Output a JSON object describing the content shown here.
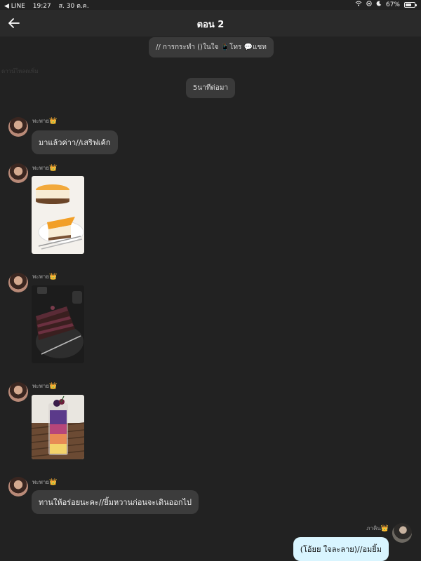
{
  "status_bar": {
    "carrier": "◀ LINE",
    "time": "19:27",
    "date": "ส. 30 ต.ค.",
    "battery": "67%",
    "battery_level": 0.67
  },
  "header": {
    "title": "ตอน 2"
  },
  "system_messages": [
    {
      "text": "// การกระทำ ()ในใจ 📱โทร 💬แชท"
    },
    {
      "text": "5นาทีต่อมา"
    }
  ],
  "faint_text": "ดาวน์โหลดเพิ่ม",
  "messages": [
    {
      "sender": "พะพาย",
      "badge": "👑",
      "text": "มาแล้วค่าา//เสริฟเค้ก"
    },
    {
      "sender": "พะพาย",
      "badge": "👑",
      "image": "orange-cheesecake"
    },
    {
      "sender": "พะพาย",
      "badge": "👑",
      "image": "chocolate-cake"
    },
    {
      "sender": "พะพาย",
      "badge": "👑",
      "image": "berry-drink"
    },
    {
      "sender": "พะพาย",
      "badge": "👑",
      "text": "ทานให้อร่อยนะคะ//ยิ้มหวานก่อนจะเดินออกไป"
    },
    {
      "sender": "ภาคิน",
      "badge": "👑",
      "text": "(โอ้ยย ใจละลาย)//อมยิ้ม"
    }
  ],
  "colors": {
    "background": "#222222",
    "bubble": "#3c3c3c",
    "outgoing_bubble": "#d9f5ff",
    "crown": "#f0c419"
  }
}
